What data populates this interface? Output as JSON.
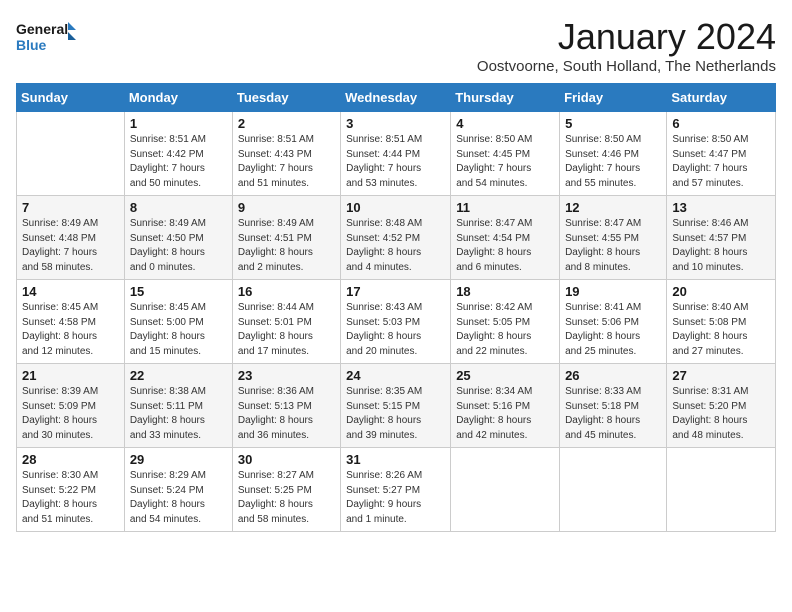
{
  "logo": {
    "line1": "General",
    "line2": "Blue"
  },
  "title": "January 2024",
  "location": "Oostvoorne, South Holland, The Netherlands",
  "days_header": [
    "Sunday",
    "Monday",
    "Tuesday",
    "Wednesday",
    "Thursday",
    "Friday",
    "Saturday"
  ],
  "weeks": [
    [
      {
        "num": "",
        "info": ""
      },
      {
        "num": "1",
        "info": "Sunrise: 8:51 AM\nSunset: 4:42 PM\nDaylight: 7 hours\nand 50 minutes."
      },
      {
        "num": "2",
        "info": "Sunrise: 8:51 AM\nSunset: 4:43 PM\nDaylight: 7 hours\nand 51 minutes."
      },
      {
        "num": "3",
        "info": "Sunrise: 8:51 AM\nSunset: 4:44 PM\nDaylight: 7 hours\nand 53 minutes."
      },
      {
        "num": "4",
        "info": "Sunrise: 8:50 AM\nSunset: 4:45 PM\nDaylight: 7 hours\nand 54 minutes."
      },
      {
        "num": "5",
        "info": "Sunrise: 8:50 AM\nSunset: 4:46 PM\nDaylight: 7 hours\nand 55 minutes."
      },
      {
        "num": "6",
        "info": "Sunrise: 8:50 AM\nSunset: 4:47 PM\nDaylight: 7 hours\nand 57 minutes."
      }
    ],
    [
      {
        "num": "7",
        "info": "Sunrise: 8:49 AM\nSunset: 4:48 PM\nDaylight: 7 hours\nand 58 minutes."
      },
      {
        "num": "8",
        "info": "Sunrise: 8:49 AM\nSunset: 4:50 PM\nDaylight: 8 hours\nand 0 minutes."
      },
      {
        "num": "9",
        "info": "Sunrise: 8:49 AM\nSunset: 4:51 PM\nDaylight: 8 hours\nand 2 minutes."
      },
      {
        "num": "10",
        "info": "Sunrise: 8:48 AM\nSunset: 4:52 PM\nDaylight: 8 hours\nand 4 minutes."
      },
      {
        "num": "11",
        "info": "Sunrise: 8:47 AM\nSunset: 4:54 PM\nDaylight: 8 hours\nand 6 minutes."
      },
      {
        "num": "12",
        "info": "Sunrise: 8:47 AM\nSunset: 4:55 PM\nDaylight: 8 hours\nand 8 minutes."
      },
      {
        "num": "13",
        "info": "Sunrise: 8:46 AM\nSunset: 4:57 PM\nDaylight: 8 hours\nand 10 minutes."
      }
    ],
    [
      {
        "num": "14",
        "info": "Sunrise: 8:45 AM\nSunset: 4:58 PM\nDaylight: 8 hours\nand 12 minutes."
      },
      {
        "num": "15",
        "info": "Sunrise: 8:45 AM\nSunset: 5:00 PM\nDaylight: 8 hours\nand 15 minutes."
      },
      {
        "num": "16",
        "info": "Sunrise: 8:44 AM\nSunset: 5:01 PM\nDaylight: 8 hours\nand 17 minutes."
      },
      {
        "num": "17",
        "info": "Sunrise: 8:43 AM\nSunset: 5:03 PM\nDaylight: 8 hours\nand 20 minutes."
      },
      {
        "num": "18",
        "info": "Sunrise: 8:42 AM\nSunset: 5:05 PM\nDaylight: 8 hours\nand 22 minutes."
      },
      {
        "num": "19",
        "info": "Sunrise: 8:41 AM\nSunset: 5:06 PM\nDaylight: 8 hours\nand 25 minutes."
      },
      {
        "num": "20",
        "info": "Sunrise: 8:40 AM\nSunset: 5:08 PM\nDaylight: 8 hours\nand 27 minutes."
      }
    ],
    [
      {
        "num": "21",
        "info": "Sunrise: 8:39 AM\nSunset: 5:09 PM\nDaylight: 8 hours\nand 30 minutes."
      },
      {
        "num": "22",
        "info": "Sunrise: 8:38 AM\nSunset: 5:11 PM\nDaylight: 8 hours\nand 33 minutes."
      },
      {
        "num": "23",
        "info": "Sunrise: 8:36 AM\nSunset: 5:13 PM\nDaylight: 8 hours\nand 36 minutes."
      },
      {
        "num": "24",
        "info": "Sunrise: 8:35 AM\nSunset: 5:15 PM\nDaylight: 8 hours\nand 39 minutes."
      },
      {
        "num": "25",
        "info": "Sunrise: 8:34 AM\nSunset: 5:16 PM\nDaylight: 8 hours\nand 42 minutes."
      },
      {
        "num": "26",
        "info": "Sunrise: 8:33 AM\nSunset: 5:18 PM\nDaylight: 8 hours\nand 45 minutes."
      },
      {
        "num": "27",
        "info": "Sunrise: 8:31 AM\nSunset: 5:20 PM\nDaylight: 8 hours\nand 48 minutes."
      }
    ],
    [
      {
        "num": "28",
        "info": "Sunrise: 8:30 AM\nSunset: 5:22 PM\nDaylight: 8 hours\nand 51 minutes."
      },
      {
        "num": "29",
        "info": "Sunrise: 8:29 AM\nSunset: 5:24 PM\nDaylight: 8 hours\nand 54 minutes."
      },
      {
        "num": "30",
        "info": "Sunrise: 8:27 AM\nSunset: 5:25 PM\nDaylight: 8 hours\nand 58 minutes."
      },
      {
        "num": "31",
        "info": "Sunrise: 8:26 AM\nSunset: 5:27 PM\nDaylight: 9 hours\nand 1 minute."
      },
      {
        "num": "",
        "info": ""
      },
      {
        "num": "",
        "info": ""
      },
      {
        "num": "",
        "info": ""
      }
    ]
  ]
}
